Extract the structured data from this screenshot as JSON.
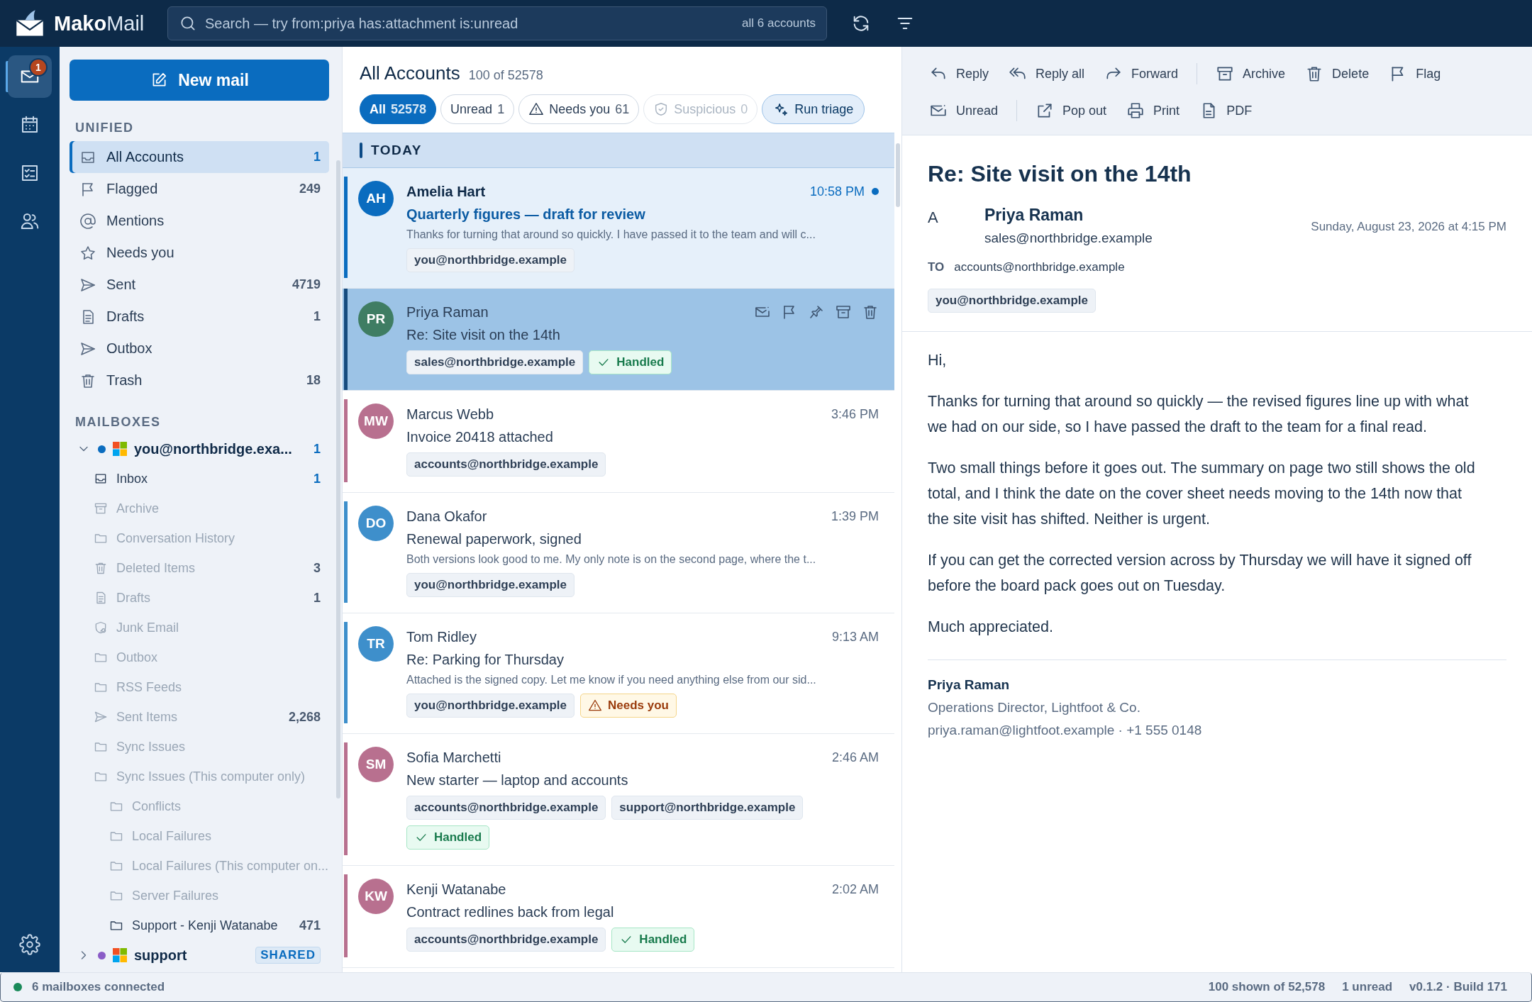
{
  "app": {
    "brand": "Mako",
    "brand_suffix": "Mail"
  },
  "search": {
    "placeholder": "Search — try from:priya has:attachment is:unread",
    "scope": "all 6 accounts"
  },
  "rail": [
    {
      "kind": "mail",
      "selected": true,
      "badge": "1"
    },
    {
      "kind": "calendar",
      "selected": false
    },
    {
      "kind": "tasks",
      "selected": false
    },
    {
      "kind": "people",
      "selected": false
    }
  ],
  "sidebar": {
    "new_mail": "New mail",
    "unified_heading": "UNIFIED",
    "unified": [
      {
        "kind": "inbox",
        "label": "All Accounts",
        "count": "1",
        "selected": true,
        "unread": true
      },
      {
        "kind": "flag",
        "label": "Flagged",
        "count": "249",
        "selected": false,
        "unread": false
      },
      {
        "kind": "at",
        "label": "Mentions",
        "selected": false
      },
      {
        "kind": "star",
        "label": "Needs you",
        "selected": false
      },
      {
        "kind": "send",
        "label": "Sent",
        "count": "4719",
        "selected": false,
        "unread": false
      },
      {
        "kind": "drafts",
        "label": "Drafts",
        "count": "1",
        "selected": false,
        "unread": false
      },
      {
        "kind": "send",
        "label": "Outbox",
        "selected": false
      },
      {
        "kind": "trash",
        "label": "Trash",
        "count": "18",
        "selected": false,
        "unread": false
      }
    ],
    "mailboxes_heading": "MAILBOXES",
    "accounts": [
      {
        "address": "you@northbridge.exa...",
        "count": "1",
        "expanded": true,
        "color": "#0a6cbf",
        "folders": [
          {
            "kind": "inbox",
            "label": "Inbox",
            "count": "1",
            "unread": true,
            "dimmed": false
          },
          {
            "kind": "archive",
            "label": "Archive",
            "dimmed": true
          },
          {
            "kind": "folder",
            "label": "Conversation History",
            "dimmed": true
          },
          {
            "kind": "trash",
            "label": "Deleted Items",
            "count": "3",
            "unread": false,
            "dimmed": true
          },
          {
            "kind": "drafts",
            "label": "Drafts",
            "count": "1",
            "unread": false,
            "dimmed": true
          },
          {
            "kind": "junk",
            "label": "Junk Email",
            "dimmed": true
          },
          {
            "kind": "folder",
            "label": "Outbox",
            "dimmed": true
          },
          {
            "kind": "folder",
            "label": "RSS Feeds",
            "dimmed": true
          },
          {
            "kind": "send",
            "label": "Sent Items",
            "count": "2,268",
            "unread": false,
            "dimmed": true
          },
          {
            "kind": "folder",
            "label": "Sync Issues",
            "dimmed": true
          },
          {
            "kind": "folder",
            "label": "Sync Issues (This computer only)",
            "dimmed": true,
            "children": [
              {
                "kind": "folder",
                "label": "Conflicts",
                "dimmed": true
              },
              {
                "kind": "folder",
                "label": "Local Failures",
                "dimmed": true
              },
              {
                "kind": "folder",
                "label": "Local Failures (This computer on...",
                "dimmed": true
              },
              {
                "kind": "folder",
                "label": "Server Failures",
                "dimmed": true
              },
              {
                "kind": "folder",
                "label": "Support - Kenji Watanabe",
                "count": "471",
                "unread": false,
                "dimmed": false
              }
            ]
          }
        ]
      },
      {
        "address": "support",
        "badge": "SHARED",
        "expanded": false,
        "color": "#8a5cc7"
      }
    ]
  },
  "list": {
    "title": "All Accounts",
    "subtitle": "100 of 52578",
    "filters": [
      {
        "kind": "plain",
        "label": "All",
        "count": "52578",
        "selected": true,
        "disabled": false
      },
      {
        "kind": "plain",
        "label": "Unread",
        "count": "1",
        "selected": false,
        "disabled": false
      },
      {
        "kind": "warning",
        "label": "Needs you",
        "count": "61",
        "selected": false,
        "disabled": false
      },
      {
        "kind": "shield",
        "label": "Suspicious",
        "count": "0",
        "selected": false,
        "disabled": true
      }
    ],
    "triage": "Run triage",
    "group": "TODAY",
    "messages": [
      {
        "initials": "AH",
        "color": "#0a6cbf",
        "sender": "Amelia Hart",
        "time": "10:58 PM",
        "subject": "Quarterly figures — draft for review",
        "preview": "Thanks for turning that around so quickly. I have passed it to the team and will c...",
        "tags": [
          "you@northbridge.example"
        ],
        "unread": true,
        "selected": false
      },
      {
        "initials": "PR",
        "color": "#3f7d63",
        "sender": "Priya Raman",
        "subject": "Re: Site visit on the 14th",
        "tags": [
          "sales@northbridge.example"
        ],
        "status": {
          "kind": "handled",
          "label": "Handled"
        },
        "unread": false,
        "selected": true
      },
      {
        "initials": "MW",
        "color": "#b8708f",
        "sender": "Marcus Webb",
        "time": "3:46 PM",
        "subject": "Invoice 20418 attached",
        "tags": [
          "accounts@northbridge.example"
        ],
        "unread": false,
        "selected": false
      },
      {
        "initials": "DO",
        "color": "#3e8fcb",
        "sender": "Dana Okafor",
        "time": "1:39 PM",
        "subject": "Renewal paperwork, signed",
        "preview": "Both versions look good to me. My only note is on the second page, where the t...",
        "tags": [
          "you@northbridge.example"
        ],
        "unread": false,
        "selected": false
      },
      {
        "initials": "TR",
        "color": "#3e8fcb",
        "sender": "Tom Ridley",
        "time": "9:13 AM",
        "subject": "Re: Parking for Thursday",
        "preview": "Attached is the signed copy. Let me know if you need anything else from our sid...",
        "tags": [
          "you@northbridge.example"
        ],
        "status": {
          "kind": "needs",
          "label": "Needs you"
        },
        "unread": false,
        "selected": false
      },
      {
        "initials": "SM",
        "color": "#b8708f",
        "sender": "Sofia Marchetti",
        "time": "2:46 AM",
        "subject": "New starter — laptop and accounts",
        "tags": [
          "accounts@northbridge.example",
          "support@northbridge.example"
        ],
        "status": {
          "kind": "handled",
          "label": "Handled"
        },
        "unread": false,
        "selected": false
      },
      {
        "initials": "KW",
        "color": "#b8708f",
        "sender": "Kenji Watanabe",
        "time": "2:02 AM",
        "subject": "Contract redlines back from legal",
        "tags": [
          "accounts@northbridge.example"
        ],
        "status": {
          "kind": "handled",
          "label": "Handled"
        },
        "unread": false,
        "selected": false
      }
    ]
  },
  "reader": {
    "toolbar_rows": [
      [
        [
          {
            "kind": "reply",
            "label": "Reply"
          },
          {
            "kind": "replyall",
            "label": "Reply all"
          },
          {
            "kind": "forward",
            "label": "Forward"
          }
        ],
        [
          {
            "kind": "archive",
            "label": "Archive"
          },
          {
            "kind": "trash",
            "label": "Delete"
          },
          {
            "kind": "flag",
            "label": "Flag"
          }
        ]
      ],
      [
        [
          {
            "kind": "maildot",
            "label": "Unread"
          }
        ],
        [
          {
            "kind": "popout",
            "label": "Pop out"
          },
          {
            "kind": "print",
            "label": "Print"
          },
          {
            "kind": "document",
            "label": "PDF"
          }
        ]
      ]
    ],
    "subject": "Re: Site visit on the 14th",
    "avatar": "A",
    "sender": "Priya Raman",
    "email": "sales@northbridge.example",
    "date": "Sunday, August 23, 2026 at 4:15 PM",
    "to_label": "TO",
    "to": "accounts@northbridge.example",
    "tag": "you@northbridge.example",
    "body": [
      "Hi,",
      "Thanks for turning that around so quickly — the revised figures line up with what we had on our side, so I have passed the draft to the team for a final read.",
      "Two small things before it goes out. The summary on page two still shows the old total, and I think the date on the cover sheet needs moving to the 14th now that the site visit has shifted. Neither is urgent.",
      "If you can get the corrected version across by Thursday we will have it signed off before the board pack goes out on Tuesday.",
      "Much appreciated."
    ],
    "signature": {
      "name": "Priya Raman",
      "title": "Operations Director, Lightfoot & Co.",
      "contact": "priya.raman@lightfoot.example · +1 555 0148"
    }
  },
  "status_bar": {
    "color": "#1a8a5a",
    "connected": "6 mailboxes connected",
    "shown": "100 shown of 52,578",
    "unread": "1 unread",
    "version": "v0.1.2 · Build 171"
  }
}
